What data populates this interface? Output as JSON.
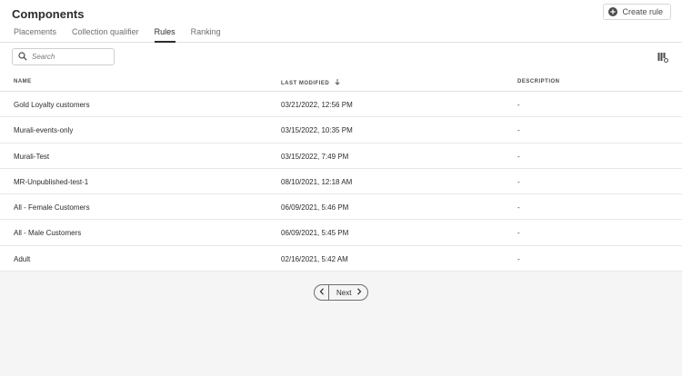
{
  "header": {
    "title": "Components",
    "create_label": "Create rule"
  },
  "tabs": [
    {
      "label": "Placements",
      "active": false
    },
    {
      "label": "Collection qualifier",
      "active": false
    },
    {
      "label": "Rules",
      "active": true
    },
    {
      "label": "Ranking",
      "active": false
    }
  ],
  "search": {
    "placeholder": "Search"
  },
  "table": {
    "columns": {
      "name": "NAME",
      "modified": "LAST MODIFIED",
      "description": "DESCRIPTION"
    },
    "rows": [
      {
        "name": "Gold Loyalty customers",
        "modified": "03/21/2022, 12:56 PM",
        "description": "-"
      },
      {
        "name": "Murali-events-only",
        "modified": "03/15/2022, 10:35 PM",
        "description": "-"
      },
      {
        "name": "Murali-Test",
        "modified": "03/15/2022, 7:49 PM",
        "description": "-"
      },
      {
        "name": "MR-Unpublished-test-1",
        "modified": "08/10/2021, 12:18 AM",
        "description": "-"
      },
      {
        "name": "All - Female Customers",
        "modified": "06/09/2021, 5:46 PM",
        "description": "-"
      },
      {
        "name": "All - Male Customers",
        "modified": "06/09/2021, 5:45 PM",
        "description": "-"
      },
      {
        "name": "Adult",
        "modified": "02/16/2021, 5:42 AM",
        "description": "-"
      }
    ]
  },
  "pagination": {
    "next_label": "Next"
  },
  "icons": {
    "create": "add-circle-icon",
    "search": "search-icon",
    "sort": "arrow-down-icon",
    "columns": "column-settings-icon",
    "prev": "chevron-left-icon",
    "next": "chevron-right-icon"
  }
}
